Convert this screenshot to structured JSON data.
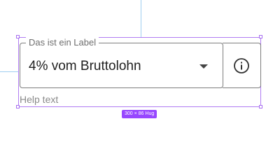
{
  "select_field": {
    "label": "Das ist ein Label",
    "value": "4% vom Bruttolohn",
    "helper_text": "Help text",
    "dropdown_icon": "arrow-drop-down",
    "info_icon": "info-circle-outline"
  },
  "design_overlay": {
    "size_badge": "300 × 86 Hug",
    "selection_color": "#9747ff",
    "guide_color": "#9fcff0"
  },
  "colors": {
    "border": "#7d7d7d",
    "label": "#6e6e6e",
    "value": "#1f1f1f",
    "helper": "#8a8a8a"
  }
}
